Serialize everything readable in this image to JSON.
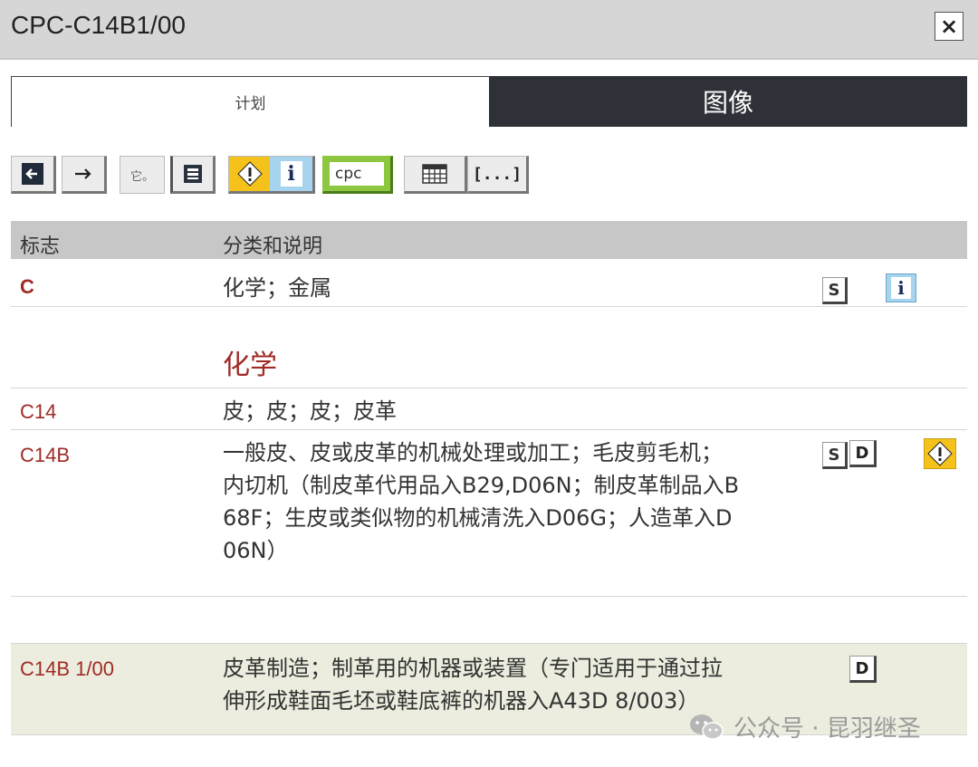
{
  "window": {
    "title": "CPC-C14B1/00",
    "close_label": "×"
  },
  "tabs": [
    {
      "label": "计划",
      "active": true
    },
    {
      "label": "图像",
      "active": false
    }
  ],
  "toolbar": {
    "buttons": [
      {
        "name": "back",
        "icon": "arrow-left-icon"
      },
      {
        "name": "forward",
        "icon": "arrow-right-icon"
      },
      {
        "name": "other",
        "icon": "text-icon",
        "label": "它。"
      },
      {
        "name": "tree",
        "icon": "tree-icon"
      },
      {
        "name": "warning",
        "icon": "warning-icon"
      },
      {
        "name": "info",
        "icon": "info-icon",
        "label": "i"
      },
      {
        "name": "cpc",
        "icon": "cpc-icon",
        "label": "cpc"
      },
      {
        "name": "table",
        "icon": "grid-icon"
      },
      {
        "name": "more",
        "icon": "ellipsis-icon",
        "label": "[...]"
      }
    ],
    "accent_green": "#8dc63f",
    "accent_yellow": "#f4c21a"
  },
  "table": {
    "headers": {
      "symbol": "标志",
      "description": "分类和说明"
    },
    "rows": [
      {
        "symbol": "C",
        "lines": [
          "化学；金属"
        ]
      },
      {
        "symbol": "C14",
        "lines": [
          "皮；皮；皮；皮革"
        ]
      },
      {
        "symbol": "C14B",
        "lines": [
          "一般皮、皮或皮革的机械处理或加工；毛皮剪毛机；",
          "内切机（制皮革代用品入B29,D06N；制皮革制品入B",
          "68F；生皮或类似物的机械清洗入D06G；人造革入D",
          "06N）"
        ]
      },
      {
        "symbol": "C14B 1/00",
        "lines": [
          "皮革制造；制革用的机器或装置（专门适用于通过拉",
          "伸形成鞋面毛坯或鞋底裤的机器入A43D 8/003）"
        ]
      }
    ],
    "section_title": "化学",
    "symbol_color": "#a02a25",
    "icon_labels": {
      "s": "S",
      "i": "i",
      "d": "D",
      "warn": "!"
    }
  },
  "watermark": {
    "text": "公众号 · 昆羽继圣"
  }
}
